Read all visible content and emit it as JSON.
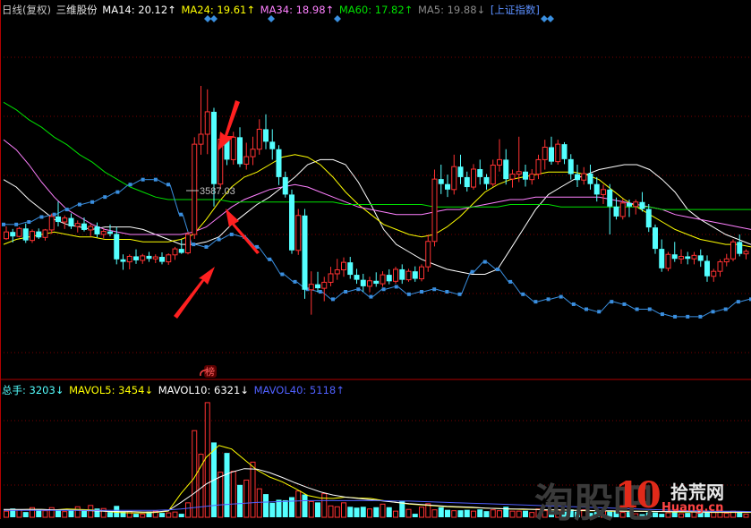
{
  "colors": {
    "bg": "#000000",
    "grid": "#7a0000",
    "up": "#ff3232",
    "down": "#54ffff",
    "index": "#3a8fe0",
    "ma14": "#ffffff",
    "ma24": "#ffff00",
    "ma34": "#ff80ff",
    "ma60": "#00e000",
    "ma5": "#8a8a8a",
    "arrow": "#ff2020",
    "vol_label": "#54ffff",
    "mavol5": "#ffff00",
    "mavol10": "#ffffff",
    "mavol40": "#5060ff"
  },
  "header": {
    "period": "日线(复权)",
    "stock": "三维股份",
    "ma14": "MA14: 20.12↑",
    "ma24": "MA24: 19.61↑",
    "ma34": "MA34: 18.98↑",
    "ma60": "MA60: 17.82↑",
    "ma5": "MA5: 19.88↓",
    "index_link": "[上证指数]"
  },
  "volume_header": {
    "total": "总手: 3203↓",
    "mavol5": "MAVOL5: 3454↓",
    "mavol10": "MAVOL10: 6321↓",
    "mavol40": "MAVOL40: 5118↑"
  },
  "annotation": {
    "index_high_label": "3587.03",
    "badge": "榜"
  },
  "watermark": {
    "ten": "10",
    "site": "Huang.cn",
    "cn": "拾荒网",
    "ghost": "淘股吧"
  },
  "chart_data": {
    "type": "candlestick",
    "price_min": 14.5,
    "price_max": 28.0,
    "candles_ohlc": [
      [
        19.43,
        19.92,
        19.38,
        19.7
      ],
      [
        19.7,
        19.82,
        19.28,
        19.52
      ],
      [
        19.52,
        19.9,
        19.48,
        19.84
      ],
      [
        19.84,
        20.04,
        19.26,
        19.36
      ],
      [
        19.36,
        19.8,
        19.26,
        19.72
      ],
      [
        19.72,
        19.84,
        19.42,
        19.48
      ],
      [
        19.48,
        19.82,
        19.35,
        19.78
      ],
      [
        19.78,
        20.44,
        19.62,
        20.32
      ],
      [
        20.32,
        20.92,
        19.92,
        20.1
      ],
      [
        20.1,
        20.36,
        19.82,
        20.26
      ],
      [
        20.26,
        20.44,
        19.82,
        19.92
      ],
      [
        19.92,
        20.16,
        19.68,
        20.04
      ],
      [
        20.04,
        20.28,
        19.72,
        19.78
      ],
      [
        19.78,
        20.02,
        19.52,
        19.92
      ],
      [
        19.92,
        20.08,
        19.48,
        19.6
      ],
      [
        19.6,
        19.82,
        19.45,
        19.72
      ],
      [
        19.72,
        20.0,
        19.52,
        19.62
      ],
      [
        19.62,
        19.9,
        18.4,
        18.6
      ],
      [
        18.6,
        18.8,
        18.18,
        18.5
      ],
      [
        18.5,
        18.8,
        18.2,
        18.72
      ],
      [
        18.72,
        19.0,
        18.42,
        18.56
      ],
      [
        18.56,
        18.82,
        18.42,
        18.74
      ],
      [
        18.74,
        18.9,
        18.5,
        18.62
      ],
      [
        18.62,
        18.8,
        18.45,
        18.7
      ],
      [
        18.7,
        18.88,
        18.4,
        18.5
      ],
      [
        18.5,
        18.84,
        18.38,
        18.78
      ],
      [
        18.78,
        19.1,
        18.58,
        19.02
      ],
      [
        19.02,
        19.4,
        18.82,
        18.86
      ],
      [
        18.86,
        19.7,
        18.8,
        19.6
      ],
      [
        19.6,
        23.5,
        19.42,
        23.22
      ],
      [
        23.22,
        25.56,
        22.8,
        23.62
      ],
      [
        23.62,
        25.42,
        22.82,
        24.52
      ],
      [
        24.52,
        24.68,
        20.72,
        21.62
      ],
      [
        21.62,
        23.58,
        21.42,
        23.42
      ],
      [
        23.42,
        23.82,
        22.38,
        22.6
      ],
      [
        22.6,
        23.72,
        22.4,
        23.5
      ],
      [
        23.5,
        23.9,
        22.3,
        22.42
      ],
      [
        22.42,
        23.28,
        22.2,
        22.72
      ],
      [
        22.72,
        23.52,
        22.38,
        23.02
      ],
      [
        23.02,
        24.22,
        22.8,
        23.82
      ],
      [
        23.82,
        24.42,
        23.02,
        23.32
      ],
      [
        23.32,
        23.82,
        22.6,
        23.02
      ],
      [
        23.02,
        23.18,
        21.58,
        21.9
      ],
      [
        21.9,
        22.12,
        21.08,
        21.2
      ],
      [
        21.2,
        21.4,
        18.82,
        18.96
      ],
      [
        18.96,
        20.62,
        18.78,
        20.36
      ],
      [
        20.36,
        20.62,
        17.02,
        17.38
      ],
      [
        17.38,
        18.12,
        16.38,
        17.6
      ],
      [
        17.6,
        18.1,
        17.28,
        17.44
      ],
      [
        17.44,
        17.9,
        16.92,
        17.68
      ],
      [
        17.68,
        18.3,
        17.52,
        18.02
      ],
      [
        18.02,
        18.62,
        17.78,
        18.18
      ],
      [
        18.18,
        18.68,
        17.9,
        18.48
      ],
      [
        18.48,
        18.7,
        17.82,
        17.98
      ],
      [
        17.98,
        18.22,
        17.62,
        17.78
      ],
      [
        17.78,
        18.02,
        17.3,
        17.52
      ],
      [
        17.52,
        17.9,
        17.28,
        17.74
      ],
      [
        17.74,
        18.08,
        17.5,
        17.62
      ],
      [
        17.62,
        18.12,
        17.5,
        17.98
      ],
      [
        17.98,
        18.2,
        17.6,
        17.72
      ],
      [
        17.72,
        18.3,
        17.62,
        18.2
      ],
      [
        18.2,
        18.4,
        17.62,
        17.78
      ],
      [
        17.78,
        18.22,
        17.7,
        18.12
      ],
      [
        18.12,
        18.32,
        17.7,
        17.82
      ],
      [
        17.82,
        18.4,
        17.72,
        18.3
      ],
      [
        18.3,
        19.6,
        18.1,
        19.32
      ],
      [
        19.32,
        22.2,
        19.12,
        21.82
      ],
      [
        21.82,
        22.4,
        21.22,
        21.62
      ],
      [
        21.62,
        22.0,
        21.1,
        21.4
      ],
      [
        21.4,
        22.8,
        21.2,
        22.32
      ],
      [
        22.32,
        22.8,
        21.62,
        21.9
      ],
      [
        21.9,
        22.12,
        21.32,
        21.5
      ],
      [
        21.5,
        22.42,
        21.4,
        22.22
      ],
      [
        22.22,
        22.6,
        21.6,
        21.9
      ],
      [
        21.9,
        22.02,
        21.4,
        21.62
      ],
      [
        21.62,
        22.6,
        21.52,
        22.38
      ],
      [
        22.38,
        23.42,
        22.12,
        22.6
      ],
      [
        22.6,
        23.02,
        21.6,
        21.82
      ],
      [
        21.82,
        22.2,
        21.48,
        22.02
      ],
      [
        22.02,
        23.52,
        21.7,
        22.12
      ],
      [
        22.12,
        22.4,
        21.52,
        21.8
      ],
      [
        21.8,
        22.22,
        21.6,
        22.02
      ],
      [
        22.02,
        22.8,
        21.82,
        22.6
      ],
      [
        22.6,
        23.4,
        22.2,
        23.1
      ],
      [
        23.1,
        23.52,
        22.4,
        22.52
      ],
      [
        22.52,
        23.4,
        22.4,
        23.22
      ],
      [
        23.22,
        23.3,
        22.42,
        22.62
      ],
      [
        22.62,
        22.82,
        21.8,
        22.02
      ],
      [
        22.02,
        22.4,
        21.5,
        21.78
      ],
      [
        21.78,
        22.3,
        21.6,
        22.04
      ],
      [
        22.04,
        22.4,
        21.4,
        21.62
      ],
      [
        21.62,
        21.9,
        20.92,
        21.2
      ],
      [
        21.2,
        21.6,
        20.82,
        21.4
      ],
      [
        21.4,
        21.62,
        19.6,
        20.72
      ],
      [
        20.72,
        21.08,
        20.2,
        20.32
      ],
      [
        20.32,
        21.02,
        20.2,
        20.86
      ],
      [
        20.86,
        21.0,
        20.3,
        20.72
      ],
      [
        20.72,
        21.0,
        20.4,
        20.9
      ],
      [
        20.9,
        21.3,
        20.52,
        20.62
      ],
      [
        20.62,
        20.82,
        19.7,
        19.88
      ],
      [
        19.88,
        20.0,
        18.82,
        19.02
      ],
      [
        19.02,
        19.4,
        18.1,
        18.24
      ],
      [
        18.24,
        18.9,
        18.12,
        18.8
      ],
      [
        18.8,
        19.3,
        18.5,
        18.62
      ],
      [
        18.62,
        19.0,
        18.42,
        18.72
      ],
      [
        18.72,
        18.9,
        18.4,
        18.62
      ],
      [
        18.62,
        18.9,
        18.4,
        18.76
      ],
      [
        18.76,
        19.0,
        18.3,
        18.54
      ],
      [
        18.54,
        18.76,
        17.7,
        17.92
      ],
      [
        17.92,
        18.22,
        17.7,
        18.12
      ],
      [
        18.12,
        18.6,
        17.9,
        18.5
      ],
      [
        18.5,
        18.82,
        18.32,
        18.62
      ],
      [
        18.62,
        19.4,
        18.52,
        19.3
      ],
      [
        19.3,
        19.6,
        18.72,
        18.82
      ],
      [
        18.82,
        19.0,
        18.6,
        18.92
      ]
    ],
    "ma_series": [
      {
        "name": "MA14",
        "values": [
          21.8,
          21.5,
          21.0,
          20.6,
          20.2,
          20.0,
          19.9,
          19.8,
          19.9,
          19.9,
          19.9,
          19.8,
          19.6,
          19.4,
          19.2,
          19.2,
          19.3,
          19.5,
          20.0,
          20.4,
          20.8,
          21.1,
          21.5,
          21.9,
          22.4,
          22.6,
          22.6,
          22.4,
          21.7,
          20.8,
          19.8,
          19.2,
          18.9,
          18.6,
          18.4,
          18.2,
          18.1,
          18.0,
          18.0,
          18.2,
          19.0,
          19.8,
          20.6,
          21.2,
          21.5,
          21.8,
          22.0,
          22.2,
          22.3,
          22.4,
          22.4,
          22.2,
          21.8,
          21.3,
          20.6,
          20.2,
          19.9,
          19.6,
          19.4,
          19.2
        ]
      },
      {
        "name": "MA24",
        "values": [
          19.2,
          19.4,
          19.5,
          19.6,
          19.7,
          19.6,
          19.5,
          19.5,
          19.4,
          19.4,
          19.4,
          19.3,
          19.3,
          19.3,
          19.4,
          19.6,
          20.2,
          20.9,
          21.5,
          21.9,
          22.1,
          22.4,
          22.7,
          22.8,
          22.7,
          22.4,
          21.9,
          21.3,
          20.8,
          20.4,
          20.0,
          19.8,
          19.6,
          19.5,
          19.6,
          19.9,
          20.3,
          20.8,
          21.3,
          21.6,
          21.8,
          21.9,
          22.0,
          22.1,
          22.1,
          22.1,
          22.0,
          21.8,
          21.4,
          21.0,
          20.7,
          20.4,
          20.1,
          19.8,
          19.6,
          19.4,
          19.3,
          19.2,
          19.2,
          19.1
        ]
      },
      {
        "name": "MA34",
        "values": [
          23.4,
          23.0,
          22.4,
          21.7,
          21.1,
          20.6,
          20.3,
          20.0,
          19.8,
          19.7,
          19.6,
          19.6,
          19.6,
          19.6,
          19.6,
          19.7,
          19.9,
          20.3,
          20.7,
          21.0,
          21.2,
          21.4,
          21.5,
          21.6,
          21.5,
          21.3,
          21.1,
          20.9,
          20.7,
          20.6,
          20.5,
          20.4,
          20.4,
          20.4,
          20.5,
          20.6,
          20.6,
          20.7,
          20.8,
          20.9,
          21.0,
          21.0,
          21.1,
          21.1,
          21.1,
          21.1,
          21.1,
          21.1,
          21.0,
          20.9,
          20.8,
          20.7,
          20.6,
          20.4,
          20.3,
          20.2,
          20.1,
          20.0,
          19.9,
          19.8
        ]
      },
      {
        "name": "MA60",
        "values": [
          24.9,
          24.6,
          24.2,
          23.9,
          23.5,
          23.2,
          22.8,
          22.5,
          22.1,
          21.8,
          21.5,
          21.3,
          21.1,
          21.0,
          21.0,
          21.0,
          21.0,
          21.0,
          20.9,
          20.9,
          20.9,
          20.9,
          20.9,
          20.9,
          20.9,
          20.9,
          20.9,
          20.8,
          20.8,
          20.8,
          20.8,
          20.8,
          20.8,
          20.8,
          20.7,
          20.7,
          20.7,
          20.7,
          20.7,
          20.7,
          20.8,
          20.8,
          20.8,
          20.8,
          20.7,
          20.7,
          20.7,
          20.7,
          20.7,
          20.7,
          20.7,
          20.7,
          20.6,
          20.6,
          20.6,
          20.6,
          20.6,
          20.6,
          20.6,
          20.6
        ]
      }
    ],
    "index_overlay": [
      20.0,
      20.0,
      20.1,
      20.3,
      20.4,
      20.6,
      20.8,
      20.9,
      21.1,
      21.3,
      21.6,
      21.8,
      21.8,
      21.6,
      20.4,
      19.2,
      19.1,
      19.4,
      19.6,
      19.5,
      19.1,
      18.6,
      18.0,
      17.7,
      17.4,
      17.3,
      17.0,
      17.3,
      17.4,
      17.1,
      17.4,
      17.5,
      17.2,
      17.3,
      17.4,
      17.3,
      17.2,
      18.1,
      18.5,
      18.2,
      17.7,
      17.2,
      16.9,
      17.0,
      17.1,
      16.8,
      16.6,
      16.5,
      16.9,
      16.8,
      16.6,
      16.6,
      16.4,
      16.3,
      16.3,
      16.3,
      16.5,
      16.6,
      16.9,
      17.0
    ],
    "volume": [
      1.4,
      2.0,
      1.7,
      1.2,
      2.2,
      1.8,
      1.5,
      2.2,
      1.8,
      1.3,
      1.6,
      2.4,
      1.8,
      2.7,
      2.0,
      2.0,
      1.2,
      2.6,
      1.3,
      1.3,
      0.8,
      0.7,
      1.3,
      1.4,
      1.0,
      1.0,
      1.2,
      0.8,
      3.3,
      19.8,
      14.4,
      26.2,
      17.1,
      10.3,
      14.7,
      10.5,
      7.4,
      8.5,
      12.6,
      6.5,
      5.3,
      3.3,
      4.0,
      3.9,
      4.6,
      6.0,
      5.2,
      3.6,
      3.4,
      5.4,
      2.6,
      2.4,
      3.3,
      2.4,
      2.2,
      2.4,
      1.9,
      2.3,
      3.0,
      2.3,
      1.4,
      3.8,
      1.8,
      0.8,
      2.3,
      3.1,
      1.7,
      2.3,
      1.7,
      1.5,
      1.6,
      1.7,
      1.4,
      1.8,
      1.4,
      1.7,
      1.5,
      2.4,
      1.4,
      1.4,
      1.5,
      1.1,
      1.9,
      1.5,
      1.4,
      1.7,
      1.3,
      1.8,
      1.3,
      1.7,
      1.0,
      1.2,
      1.5,
      1.3,
      1.4,
      1.1,
      1.2,
      0.8,
      0.7,
      1.1,
      1.1,
      0.8,
      1.0,
      1.2,
      0.8,
      1.0,
      1.2,
      1.5,
      1.2,
      1.1,
      1.6,
      0.9,
      1.4,
      1.1,
      0.7
    ],
    "mavol_series": [
      {
        "name": "MAVOL5",
        "values": [
          1.7,
          1.7,
          1.8,
          1.8,
          1.7,
          1.9,
          1.8,
          1.7,
          1.4,
          1.1,
          1.0,
          1.0,
          1.1,
          1.4,
          5.4,
          8.8,
          13.7,
          16.4,
          15.6,
          13.2,
          10.8,
          9.2,
          8.1,
          6.6,
          5.0,
          4.4,
          4.3,
          4.6,
          4.4,
          4.3,
          3.8,
          3.4,
          3.0,
          2.8,
          2.6,
          2.4,
          2.3,
          2.2,
          2.1,
          2.0,
          1.9,
          1.8,
          1.8,
          1.7,
          1.7,
          1.6,
          1.5,
          1.5,
          1.4,
          1.4,
          1.4,
          1.3,
          1.3,
          1.2,
          1.2,
          1.2,
          1.1,
          1.1,
          1.1,
          1.1
        ]
      },
      {
        "name": "MAVOL10",
        "values": [
          1.8,
          1.8,
          1.8,
          1.8,
          1.7,
          1.7,
          1.6,
          1.5,
          1.4,
          1.3,
          1.3,
          1.2,
          1.2,
          1.5,
          3.4,
          5.4,
          7.6,
          9.1,
          10.3,
          11.1,
          11.0,
          10.2,
          9.1,
          7.9,
          6.8,
          5.8,
          5.1,
          4.6,
          4.3,
          4.0,
          3.7,
          3.4,
          3.1,
          2.9,
          2.7,
          2.5,
          2.4,
          2.3,
          2.1,
          2.0,
          1.9,
          1.9,
          1.8,
          1.7,
          1.7,
          1.6,
          1.6,
          1.5,
          1.5,
          1.4,
          1.4,
          1.4,
          1.3,
          1.3,
          1.3,
          1.2,
          1.2,
          1.2,
          1.2,
          1.2
        ]
      },
      {
        "name": "MAVOL40",
        "values": [
          1.6,
          1.6,
          1.6,
          1.6,
          1.6,
          1.6,
          1.6,
          1.6,
          1.6,
          1.6,
          1.6,
          1.6,
          1.6,
          1.7,
          1.9,
          2.2,
          2.5,
          2.8,
          3.0,
          3.2,
          3.4,
          3.5,
          3.6,
          3.7,
          3.8,
          3.8,
          3.8,
          3.8,
          3.8,
          3.8,
          3.8,
          3.7,
          3.7,
          3.6,
          3.5,
          3.4,
          3.3,
          3.2,
          3.1,
          3.0,
          2.9,
          2.8,
          2.7,
          2.6,
          2.5,
          2.4,
          2.3,
          2.2,
          2.1,
          2.0,
          1.9,
          1.8,
          1.7,
          1.6,
          1.5,
          1.5,
          1.4,
          1.4,
          1.4,
          1.3
        ]
      }
    ],
    "volume_max": 27
  }
}
